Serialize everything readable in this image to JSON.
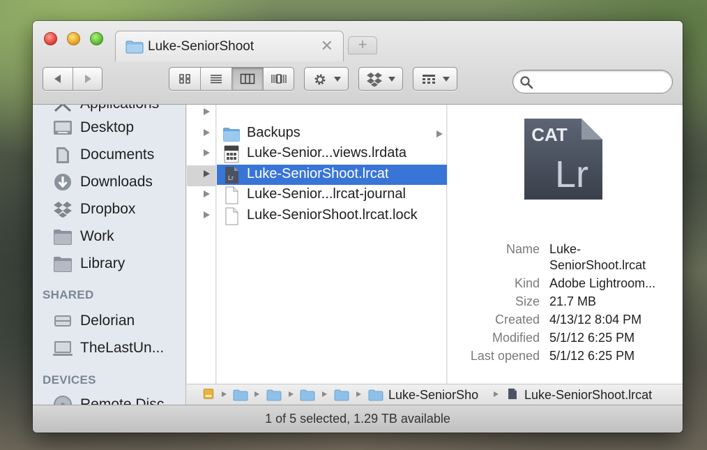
{
  "tab": {
    "title": "Luke-SeniorShoot",
    "close": "✕",
    "add": "+"
  },
  "sidebar": {
    "partial_top": "Applications",
    "favorites": [
      {
        "label": "Desktop",
        "icon": "desktop-icon"
      },
      {
        "label": "Documents",
        "icon": "documents-icon"
      },
      {
        "label": "Downloads",
        "icon": "downloads-icon"
      },
      {
        "label": "Dropbox",
        "icon": "dropbox-icon"
      },
      {
        "label": "Work",
        "icon": "folder-icon"
      },
      {
        "label": "Library",
        "icon": "folder-icon"
      }
    ],
    "shared_heading": "SHARED",
    "shared": [
      {
        "label": "Delorian",
        "icon": "server-icon"
      },
      {
        "label": "TheLastUn...",
        "icon": "display-icon"
      }
    ],
    "devices_heading": "DEVICES",
    "partial_bottom": "Remote Disc"
  },
  "files": [
    {
      "label": "Backups",
      "icon": "folder-icon",
      "has_children": true,
      "selected": false
    },
    {
      "label": "Luke-Senior...views.lrdata",
      "icon": "lrdata-icon",
      "has_children": false,
      "selected": false
    },
    {
      "label": "Luke-SeniorShoot.lrcat",
      "icon": "lrcat-icon",
      "has_children": false,
      "selected": true
    },
    {
      "label": "Luke-Senior...lrcat-journal",
      "icon": "document-icon",
      "has_children": false,
      "selected": false
    },
    {
      "label": "Luke-SeniorShoot.lrcat.lock",
      "icon": "document-icon",
      "has_children": false,
      "selected": false
    }
  ],
  "preview": {
    "icon_top": "CAT",
    "icon_main": "Lr",
    "meta": {
      "name_label": "Name",
      "name_value_1": "Luke-",
      "name_value_2": "SeniorShoot.lrcat",
      "kind_label": "Kind",
      "kind_value": "Adobe Lightroom...",
      "size_label": "Size",
      "size_value": "21.7 MB",
      "created_label": "Created",
      "created_value": "4/13/12 8:04 PM",
      "modified_label": "Modified",
      "modified_value": "5/1/12 6:25 PM",
      "opened_label": "Last opened",
      "opened_value": "5/1/12 6:25 PM"
    }
  },
  "pathbar": {
    "folder": "Luke-SeniorSho",
    "file": "Luke-SeniorShoot.lrcat"
  },
  "status": "1 of 5 selected, 1.29 TB available",
  "colors": {
    "selection": "#3875d7",
    "sidebar_bg": "#e4e9ef",
    "folder": "#8ec1e9"
  }
}
